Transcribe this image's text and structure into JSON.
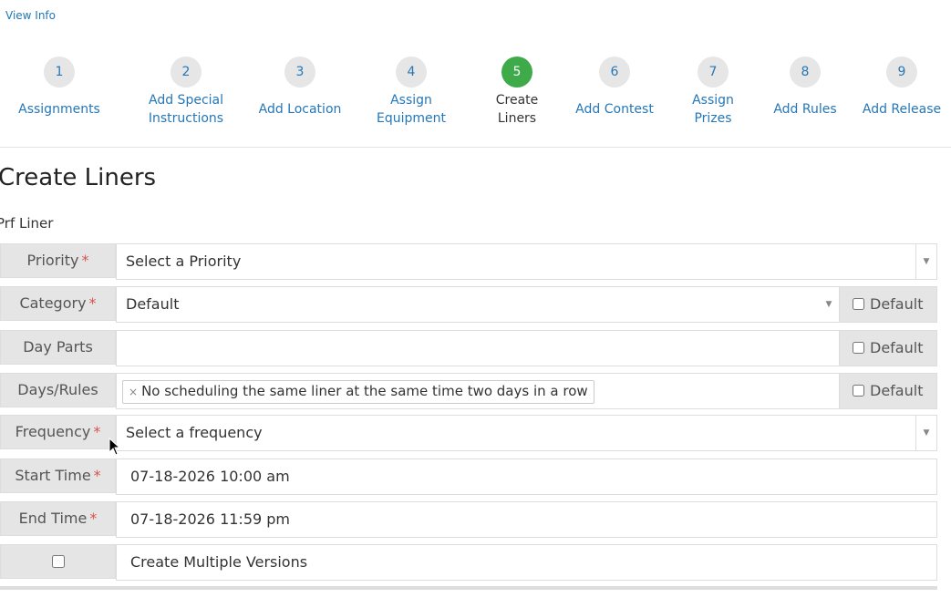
{
  "header": {
    "view_info": "View Info"
  },
  "steps": [
    {
      "number": "1",
      "label": "Assignments"
    },
    {
      "number": "2",
      "label": "Add Special Instructions"
    },
    {
      "number": "3",
      "label": "Add Location"
    },
    {
      "number": "4",
      "label": "Assign Equipment"
    },
    {
      "number": "5",
      "label": "Create Liners"
    },
    {
      "number": "6",
      "label": "Add Contest"
    },
    {
      "number": "7",
      "label": "Assign Prizes"
    },
    {
      "number": "8",
      "label": "Add Rules"
    },
    {
      "number": "9",
      "label": "Add Release"
    }
  ],
  "page": {
    "title": "Create Liners",
    "section": "Prf Liner"
  },
  "form": {
    "required_mark": "*",
    "default_label": "Default",
    "priority": {
      "label": "Priority",
      "placeholder": "Select a Priority"
    },
    "category": {
      "label": "Category",
      "value": "Default"
    },
    "day_parts": {
      "label": "Day Parts",
      "value": ""
    },
    "days_rules": {
      "label": "Days/Rules",
      "tag": "No scheduling the same liner at the same time two days in a row",
      "remove_glyph": "×"
    },
    "frequency": {
      "label": "Frequency",
      "placeholder": "Select a frequency"
    },
    "start_time": {
      "label": "Start Time",
      "value": "07-18-2026 10:00 am"
    },
    "end_time": {
      "label": "End Time",
      "value": "07-18-2026 11:59 pm"
    },
    "multiple_versions": {
      "label": "Create Multiple Versions"
    }
  },
  "colors": {
    "link": "#2577b8",
    "active_step": "#3eaa4a",
    "required": "#d9534f",
    "label_bg": "#e5e5e5"
  },
  "icons": {
    "dropdown": "caret-down-icon",
    "cursor": "mouse-pointer-icon"
  }
}
